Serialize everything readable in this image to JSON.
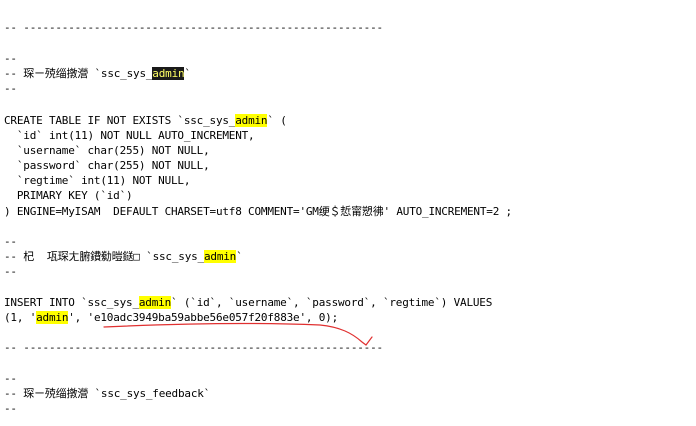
{
  "sql": {
    "sep1": "-- --------------------------------------------------------",
    "c1_blank": "--",
    "c1_prefix": "-- 琛ㄧ殑缁撴瀯 `ssc_sys_",
    "c1_hl": "admin",
    "c1_suffix": "`",
    "c1_end": "--",
    "create_prefix": "CREATE TABLE IF NOT EXISTS `ssc_sys_",
    "create_hl": "admin",
    "create_suffix": "` (",
    "col_id": "  `id` int(11) NOT NULL AUTO_INCREMENT,",
    "col_username": "  `username` char(255) NOT NULL,",
    "col_password": "  `password` char(255) NOT NULL,",
    "col_regtime": "  `regtime` int(11) NOT NULL,",
    "primary_key": "  PRIMARY KEY (`id`)",
    "engine": ") ENGINE=MyISAM  DEFAULT CHARSET=utf8 COMMENT='GM绠＄悊甯愬彿' AUTO_INCREMENT=2 ;",
    "c2_blank": "--",
    "c2_prefix": "-- 杞  瓨琛ㄤ腑鐨勬暟鎹□ `ssc_sys_",
    "c2_hl": "admin",
    "c2_suffix": "`",
    "c2_end": "--",
    "insert_prefix": "INSERT INTO `ssc_sys_",
    "insert_hl": "admin",
    "insert_suffix": "` (`id`, `username`, `password`, `regtime`) VALUES",
    "values_a": "(1, '",
    "values_hl": "admin",
    "values_b": "', 'e10adc3949ba59abbe56e057f20f883e', 0);",
    "sep2": "-- --------------------------------------------------------",
    "c3_blank": "--",
    "c3_line": "-- 琛ㄧ殑缁撴瀯 `ssc_sys_feedback`",
    "c3_end": "--"
  },
  "colors": {
    "highlight": "#ffff00",
    "highlight_dark_bg": "#1a1a1a",
    "annotation": "#e03030"
  }
}
